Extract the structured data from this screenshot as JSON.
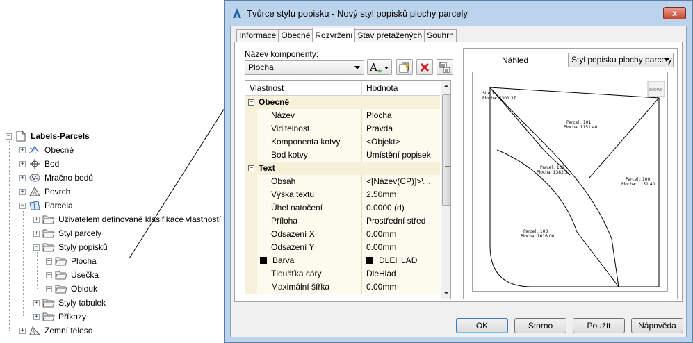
{
  "tree": {
    "root": "Labels-Parcels",
    "items": [
      {
        "label": "Obecné",
        "icon": "general-icon"
      },
      {
        "label": "Bod",
        "icon": "point-icon"
      },
      {
        "label": "Mračno bodů",
        "icon": "point-cloud-icon"
      },
      {
        "label": "Povrch",
        "icon": "surface-icon"
      },
      {
        "label": "Parcela",
        "icon": "parcel-icon"
      },
      {
        "label": "Uživatelem definované klasifikace vlastností",
        "icon": "folder-icon"
      },
      {
        "label": "Styl parcely",
        "icon": "folder-icon"
      },
      {
        "label": "Styly popisků",
        "icon": "folder-icon"
      },
      {
        "label": "Plocha",
        "icon": "folder-icon"
      },
      {
        "label": "Úsečka",
        "icon": "folder-icon"
      },
      {
        "label": "Oblouk",
        "icon": "folder-icon"
      },
      {
        "label": "Styly tabulek",
        "icon": "folder-icon"
      },
      {
        "label": "Příkazy",
        "icon": "folder-icon"
      },
      {
        "label": "Zemní těleso",
        "icon": "earthwork-icon"
      }
    ]
  },
  "dialog": {
    "title": "Tvůrce stylu popisku - Nový styl popisků plochy parcely",
    "close": "x",
    "tabs": [
      "Informace",
      "Obecné",
      "Rozvržení",
      "Stav přetažených",
      "Souhrn"
    ],
    "active_tab": "Rozvržení",
    "component_label": "Název komponenty:",
    "component_value": "Plocha",
    "grid_headers": {
      "property": "Vlastnost",
      "value": "Hodnota"
    },
    "categories": {
      "general": "Obecné",
      "text": "Text"
    },
    "rows_general": [
      {
        "name": "Název",
        "value": "Plocha"
      },
      {
        "name": "Viditelnost",
        "value": "Pravda"
      },
      {
        "name": "Komponenta kotvy",
        "value": "<Objekt>"
      },
      {
        "name": "Bod kotvy",
        "value": "Umístění popisek"
      }
    ],
    "rows_text": [
      {
        "name": "Obsah",
        "value": "<[Název(CP)]>\\..."
      },
      {
        "name": "Výška textu",
        "value": "2.50mm"
      },
      {
        "name": "Úhel natočení",
        "value": "0.0000 (d)"
      },
      {
        "name": "Příloha",
        "value": "Prostřední střed"
      },
      {
        "name": "Odsazení X",
        "value": "0.00mm"
      },
      {
        "name": "Odsazení Y",
        "value": "0.00mm"
      },
      {
        "name": "Barva",
        "value": "DLEHLAD"
      },
      {
        "name": "Tloušťka čáry",
        "value": "DleHlad"
      },
      {
        "name": "Maximální šířka",
        "value": "0.00mm"
      }
    ],
    "preview_label": "Náhled",
    "preview_style": "Styl popisku plochy parcely",
    "preview_texts": {
      "site": "Site 1",
      "site_area": "Plocha: 5301.37",
      "p101": "Parcel : 101",
      "p101_area": "Plocha: 1151.40",
      "p102": "Parcel : 102",
      "p102_area": "Plocha: 1382.57",
      "p100": "Parcel : 100",
      "p100_area": "Plocha: 1151.40",
      "p103": "Parcel : 103",
      "p103_area": "Plocha: 1616.00",
      "north": "SHOWS"
    },
    "buttons": {
      "ok": "OK",
      "cancel": "Storno",
      "apply": "Použít",
      "help": "Nápověda"
    }
  },
  "colors": {
    "dialog_bg": "#bcd3ec",
    "grid_name_bg": "#fdfaee",
    "grid_cat_bg": "#f7f1dc",
    "close_red": "#c7452f",
    "default_btn": "#3c7fb1"
  }
}
